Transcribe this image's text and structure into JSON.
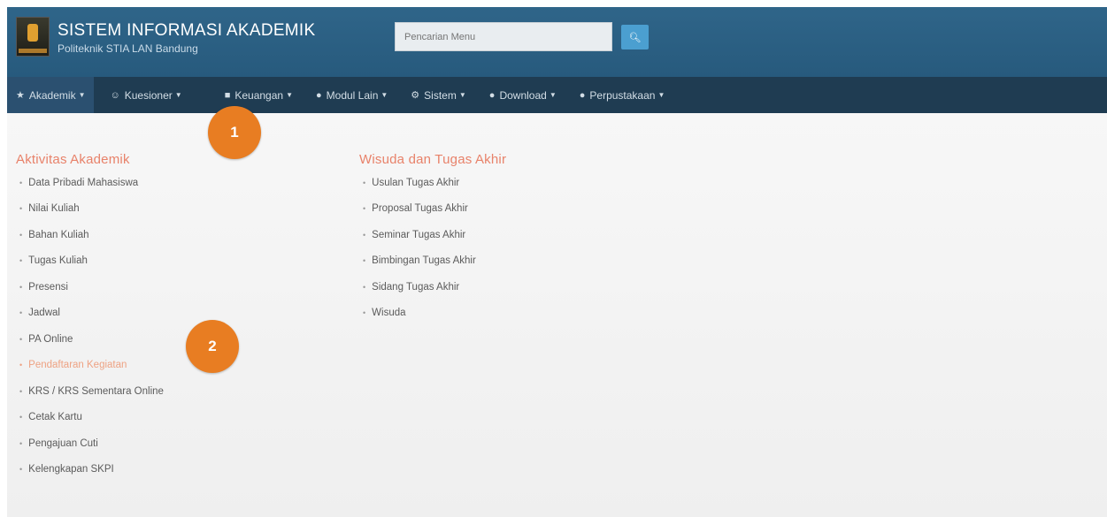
{
  "header": {
    "title": "SISTEM INFORMASI AKADEMIK",
    "subtitle": "Politeknik STIA LAN Bandung",
    "search_placeholder": "Pencarian Menu"
  },
  "navbar": {
    "items": [
      {
        "label": "Akademik",
        "icon": "institution-icon"
      },
      {
        "label": "Kuesioner",
        "icon": "users-icon"
      },
      {
        "label": "Keuangan",
        "icon": "money-icon"
      },
      {
        "label": "Modul Lain",
        "icon": "globe-icon"
      },
      {
        "label": "Sistem",
        "icon": "gear-icon"
      },
      {
        "label": "Download",
        "icon": "globe-icon"
      },
      {
        "label": "Perpustakaan",
        "icon": "globe-icon"
      }
    ]
  },
  "menu": {
    "col1": {
      "title": "Aktivitas Akademik",
      "items": [
        "Data Pribadi Mahasiswa",
        "Nilai Kuliah",
        "Bahan Kuliah",
        "Tugas Kuliah",
        "Presensi",
        "Jadwal",
        "PA Online",
        "Pendaftaran Kegiatan",
        "KRS / KRS Sementara Online",
        "Cetak Kartu",
        "Pengajuan Cuti",
        "Kelengkapan SKPI"
      ],
      "highlighted_item": "Pendaftaran Kegiatan"
    },
    "col2": {
      "title": "Wisuda dan Tugas Akhir",
      "items": [
        "Usulan Tugas Akhir",
        "Proposal Tugas Akhir",
        "Seminar Tugas Akhir",
        "Bimbingan Tugas Akhir",
        "Sidang Tugas Akhir",
        "Wisuda"
      ]
    }
  },
  "callouts": [
    "1",
    "2"
  ],
  "colors": {
    "header": "#2a5e82",
    "navbar": "#1f3c52",
    "menu_title": "#e8826a",
    "callout": "#e87d22"
  }
}
